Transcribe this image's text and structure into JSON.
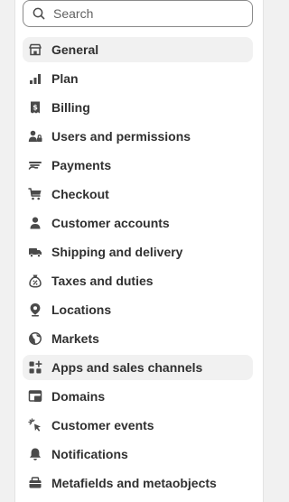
{
  "search": {
    "placeholder": "Search",
    "value": "",
    "icon": "search-icon"
  },
  "colors": {
    "icon": "#4a4a4a",
    "text": "#303030",
    "active_bg": "#f1f1f1",
    "panel_bg": "#ffffff",
    "page_bg": "#f1f1f1"
  },
  "nav": {
    "active_index": 0,
    "items": [
      {
        "label": "General",
        "icon": "store-icon"
      },
      {
        "label": "Plan",
        "icon": "plan-chart-icon"
      },
      {
        "label": "Billing",
        "icon": "billing-receipt-icon"
      },
      {
        "label": "Users and permissions",
        "icon": "users-lock-icon"
      },
      {
        "label": "Payments",
        "icon": "payments-hand-icon"
      },
      {
        "label": "Checkout",
        "icon": "cart-icon"
      },
      {
        "label": "Customer accounts",
        "icon": "person-icon"
      },
      {
        "label": "Shipping and delivery",
        "icon": "truck-icon"
      },
      {
        "label": "Taxes and duties",
        "icon": "tax-bag-icon"
      },
      {
        "label": "Locations",
        "icon": "location-pin-icon"
      },
      {
        "label": "Markets",
        "icon": "globe-icon"
      },
      {
        "label": "Apps and sales channels",
        "icon": "apps-icon"
      },
      {
        "label": "Domains",
        "icon": "domain-icon"
      },
      {
        "label": "Customer events",
        "icon": "cursor-click-icon"
      },
      {
        "label": "Notifications",
        "icon": "bell-icon"
      },
      {
        "label": "Metafields and metaobjects",
        "icon": "metafields-icon"
      }
    ]
  }
}
